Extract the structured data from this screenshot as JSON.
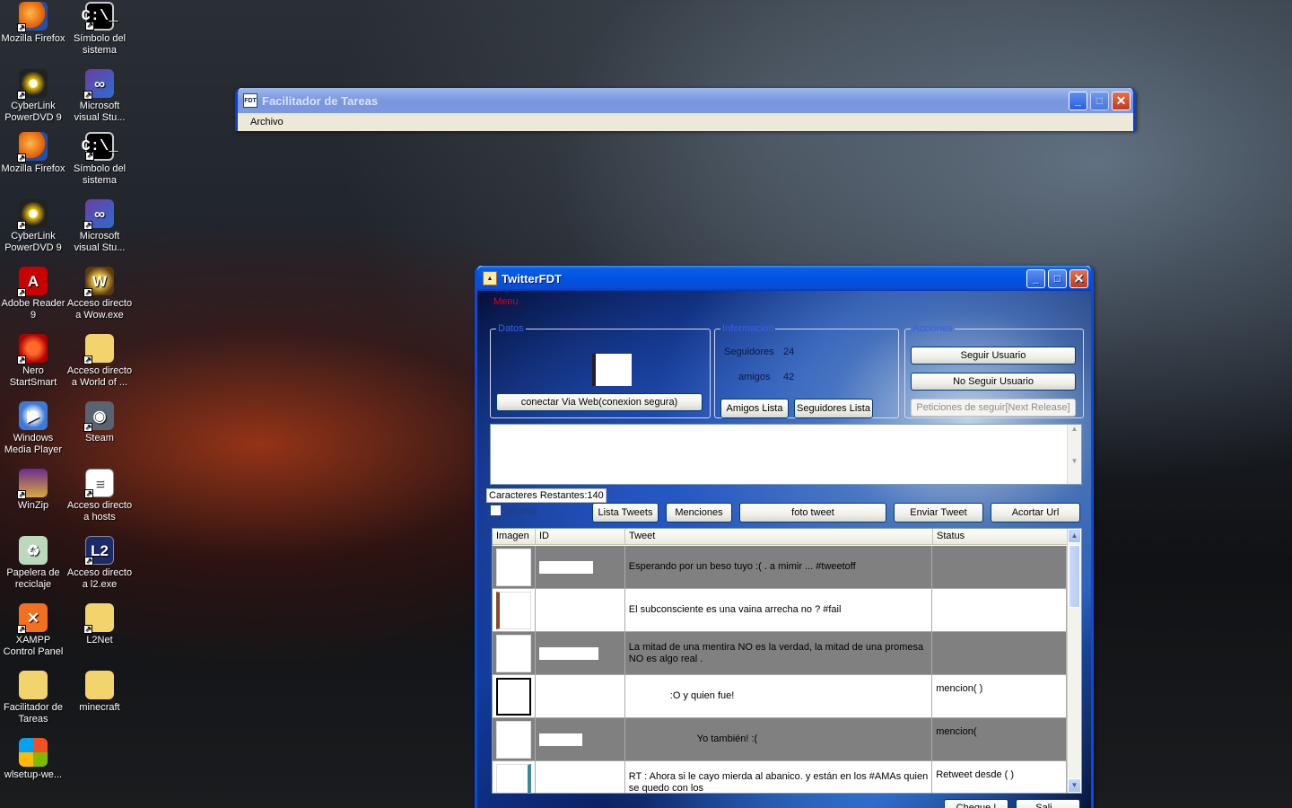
{
  "desktop": {
    "icons": [
      {
        "label": "Mozilla Firefox"
      },
      {
        "label": "Símbolo del sistema"
      },
      {
        "label": "CyberLink PowerDVD 9"
      },
      {
        "label": "Microsoft visual Stu..."
      },
      {
        "label": "Mozilla Firefox"
      },
      {
        "label": "Símbolo del sistema"
      },
      {
        "label": "CyberLink PowerDVD 9"
      },
      {
        "label": "Microsoft visual Stu..."
      },
      {
        "label": "Adobe Reader 9"
      },
      {
        "label": "Acceso directo a Wow.exe"
      },
      {
        "label": "Nero StartSmart"
      },
      {
        "label": "Acceso directo a World of ..."
      },
      {
        "label": "Windows Media Player"
      },
      {
        "label": "Steam"
      },
      {
        "label": "WinZip"
      },
      {
        "label": "Acceso directo a hosts"
      },
      {
        "label": "Papelera de reciclaje"
      },
      {
        "label": "Acceso directo a l2.exe"
      },
      {
        "label": "XAMPP Control Panel"
      },
      {
        "label": "L2Net"
      },
      {
        "label": "Facilitador de Tareas"
      },
      {
        "label": "minecraft"
      },
      {
        "label": "wlsetup-we..."
      }
    ]
  },
  "bg_window": {
    "title": "Facilitador de Tareas",
    "icon_text": "FDT",
    "menu": "Archivo"
  },
  "app": {
    "title": "TwitterFDT",
    "menu_label": "Menu",
    "datos": {
      "legend": "Datos",
      "connect_button": "conectar Via Web(conexion segura)"
    },
    "informacion": {
      "legend": "Informacion",
      "seguidores_label": "Seguidores",
      "seguidores_value": "24",
      "amigos_label": "amigos",
      "amigos_value": "42",
      "amigos_button": "Amigos Lista",
      "seguidores_button": "Seguidores Lista"
    },
    "acciones": {
      "legend": "Acciones",
      "follow_button": "Seguir Usuario",
      "unfollow_button": "No Seguir Usuario",
      "requests_button": "Peticiones de seguir[Next Release]"
    },
    "char_count": "Caracteres Restantes:140",
    "checkbox_label": "Acortar",
    "toolbar": {
      "lista": "Lista Tweets",
      "menciones": "Menciones",
      "foto": "foto tweet",
      "enviar": "Enviar Tweet",
      "acortar": "Acortar Url"
    },
    "grid": {
      "columns": [
        "Imagen",
        "ID",
        "Tweet",
        "Status"
      ],
      "rows": [
        {
          "tweet": "Esperando por un beso tuyo :( . a mimir ... #tweetoff",
          "status": ""
        },
        {
          "tweet": "El subconsciente es una vaina arrecha no ? #fail",
          "status": ""
        },
        {
          "tweet": "La mitad de una mentira NO es la verdad, la mitad de una promesa NO es algo real .",
          "status": ""
        },
        {
          "tweet": ":O y quien fue!",
          "status": "mencion(          )"
        },
        {
          "tweet": "Yo también! :(",
          "status": "mencion("
        },
        {
          "tweet": "RT                       : Ahora si le cayo mierda al abanico.              y                              están en los #AMAs quien se quedo con los",
          "status": "Retweet desde (                   )"
        }
      ]
    },
    "bottom_buttons": [
      "Cheque !",
      "Sali..."
    ]
  }
}
